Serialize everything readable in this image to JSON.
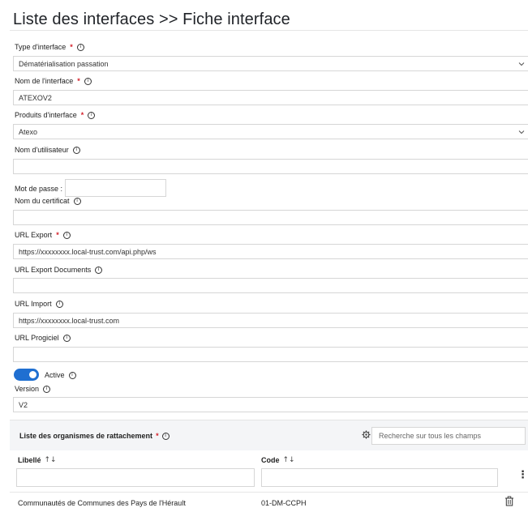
{
  "page_title": "Liste des interfaces >> Fiche interface",
  "fields": {
    "type": {
      "label": "Type d'interface",
      "value": "Dématérialisation passation"
    },
    "name": {
      "label": "Nom de l'interface",
      "value": "ATEXOV2"
    },
    "products": {
      "label": "Produits d'interface",
      "value": "Atexo"
    },
    "username": {
      "label": "Nom d'utilisateur",
      "value": ""
    },
    "password": {
      "label": "Mot de passe :"
    },
    "certificate": {
      "label": "Nom du certificat",
      "value": ""
    },
    "url_export": {
      "label": "URL Export",
      "value": "https://xxxxxxxx.local-trust.com/api.php/ws"
    },
    "url_export_docs": {
      "label": "URL Export Documents",
      "value": ""
    },
    "url_import": {
      "label": "URL Import",
      "value": "https://xxxxxxxx.local-trust.com"
    },
    "url_progiciel": {
      "label": "URL Progiciel",
      "value": ""
    },
    "active": {
      "label": "Active",
      "state": true
    },
    "version": {
      "label": "Version",
      "value": "V2"
    }
  },
  "required_mark": "*",
  "info_glyph": "i",
  "organisms": {
    "title": "Liste des organismes de rattachement",
    "search_placeholder": "Recherche sur tous les champs",
    "columns": [
      {
        "label": "Libellé",
        "sort": "↑↓"
      },
      {
        "label": "Code",
        "sort": "↑↓"
      }
    ],
    "kebab": "⋮",
    "rows": [
      {
        "libelle": "Communautés de Communes des Pays de l'Hérault",
        "code": "01-DM-CCPH"
      }
    ]
  },
  "colors": {
    "accent": "#1f6fd1",
    "required": "#d4202a",
    "border": "#d6d6d6",
    "panel": "#f4f5f7"
  },
  "icons": [
    "info-icon",
    "chevron-down-icon",
    "gear-icon",
    "sort-icon",
    "kebab-menu-icon",
    "trash-icon"
  ]
}
